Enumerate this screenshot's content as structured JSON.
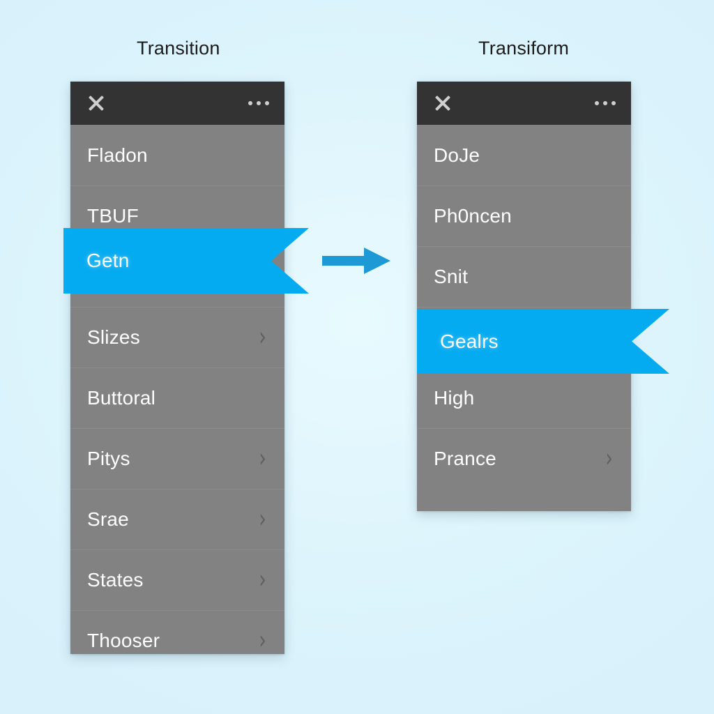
{
  "theme": {
    "background": "#e1f6fd",
    "panel_bg": "#828282",
    "titlebar_bg": "#333333",
    "accent": "#04abf1",
    "label_color": "#ffffff",
    "caption_color": "#1b1b1b"
  },
  "captions": {
    "left": "Transition",
    "right": "Transiform"
  },
  "icons": {
    "close": "close-icon",
    "more": "more-options-icon",
    "chevron": "chevron-right-icon",
    "arrow": "arrow-right-icon"
  },
  "left_panel": {
    "titlebar": {
      "close_label": "×",
      "more_label": "•••"
    },
    "selected_index": 2,
    "items": [
      {
        "label": "Fladon",
        "chevron": false,
        "selected": false
      },
      {
        "label": "TBUF",
        "chevron": false,
        "selected": false
      },
      {
        "label": "Getn",
        "chevron": true,
        "selected": true
      },
      {
        "label": "Slizes",
        "chevron": true,
        "selected": false
      },
      {
        "label": "Buttoral",
        "chevron": false,
        "selected": false
      },
      {
        "label": "Pitys",
        "chevron": true,
        "selected": false
      },
      {
        "label": "Srae",
        "chevron": true,
        "selected": false
      },
      {
        "label": "States",
        "chevron": true,
        "selected": false
      },
      {
        "label": "Thooser",
        "chevron": true,
        "selected": false
      }
    ]
  },
  "right_panel": {
    "titlebar": {
      "close_label": "×",
      "more_label": "•••"
    },
    "selected_index": 3,
    "items": [
      {
        "label": "DoJe",
        "chevron": false,
        "selected": false
      },
      {
        "label": "Ph0ncen",
        "chevron": false,
        "selected": false
      },
      {
        "label": "Snit",
        "chevron": false,
        "selected": false
      },
      {
        "label": "Gealrs",
        "chevron": true,
        "selected": true
      },
      {
        "label": "High",
        "chevron": false,
        "selected": false
      },
      {
        "label": "Prance",
        "chevron": true,
        "selected": false
      }
    ]
  },
  "flow": {
    "direction": "left-to-right",
    "arrow_color": "#1d9ad6"
  }
}
